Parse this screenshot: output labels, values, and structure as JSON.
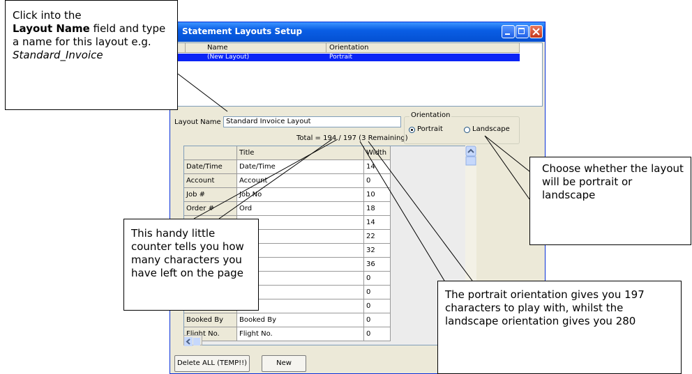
{
  "window": {
    "title": "Statement Layouts Setup"
  },
  "layout_list": {
    "headers": [
      "Name",
      "Orientation"
    ],
    "rows": [
      {
        "name": "(New Layout)",
        "orientation": "Portrait"
      }
    ]
  },
  "form": {
    "layout_name_label": "Layout Name",
    "layout_name_value": "Standard Invoice Layout",
    "total_counter": "Total = 194 / 197 (3 Remaining)",
    "orientation_label": "Orientation",
    "portrait_label": "Portrait",
    "landscape_label": "Landscape",
    "selected_orientation": "Portrait"
  },
  "grid": {
    "headers": [
      "",
      "Title",
      "Width"
    ],
    "rows": [
      {
        "field": "Date/Time",
        "title": "Date/Time",
        "width": "14"
      },
      {
        "field": "Account",
        "title": "Account",
        "width": "0"
      },
      {
        "field": "Job #",
        "title": "Job No",
        "width": "10"
      },
      {
        "field": "Order #",
        "title": "Ord",
        "width": "18"
      },
      {
        "field": "",
        "title": "",
        "width": "14"
      },
      {
        "field": "",
        "title": "",
        "width": "22"
      },
      {
        "field": "",
        "title": "",
        "width": "32"
      },
      {
        "field": "",
        "title": "",
        "width": "36"
      },
      {
        "field": "",
        "title": "",
        "width": "0"
      },
      {
        "field": "",
        "title": "",
        "width": "0"
      },
      {
        "field": "",
        "title": "",
        "width": "0"
      },
      {
        "field": "Booked By",
        "title": "Booked By",
        "width": "0"
      },
      {
        "field": "Flight No.",
        "title": "Flight No.",
        "width": "0"
      }
    ]
  },
  "buttons": {
    "delete_all": "Delete ALL (TEMP!!)",
    "new": "New"
  },
  "callouts": {
    "layout_name": {
      "line1": "Click into the",
      "bold": "Layout Name",
      "rest": " field and type a name for this layout e.g.",
      "italic": "Standard_Invoice"
    },
    "counter": "This handy little counter tells you how many characters you have left on the page",
    "orientation": "Choose whether the layout will be portrait or landscape",
    "portrait_info": "The portrait orientation gives you 197 characters to play with, whilst the landscape orientation gives you 280"
  }
}
